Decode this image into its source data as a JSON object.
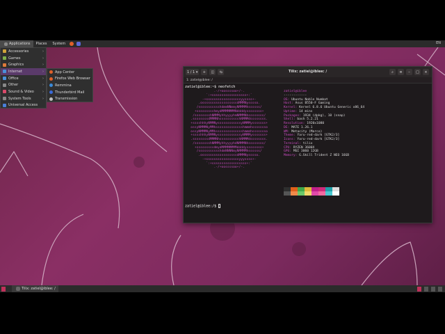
{
  "topbar": {
    "menus": [
      "Applications",
      "Places",
      "System"
    ],
    "tray": "EN"
  },
  "apps_menu": {
    "items": [
      {
        "label": "Accessories",
        "color": "#d0a33a"
      },
      {
        "label": "Games",
        "color": "#7fb04a"
      },
      {
        "label": "Graphics",
        "color": "#e07a3a"
      },
      {
        "label": "Internet",
        "color": "#4a90d9"
      },
      {
        "label": "Office",
        "color": "#4a90d9"
      },
      {
        "label": "Other",
        "color": "#888888"
      },
      {
        "label": "Sound & Video",
        "color": "#d94a6a"
      },
      {
        "label": "System Tools",
        "color": "#888888"
      },
      {
        "label": "Universal Access",
        "color": "#4a7fd9"
      }
    ],
    "submenu": [
      {
        "label": "App Center",
        "color": "#e0602a"
      },
      {
        "label": "Firefox Web Browser",
        "color": "#e0602a"
      },
      {
        "label": "Remmina",
        "color": "#3a8ad9"
      },
      {
        "label": "Thunderbird Mail",
        "color": "#3a6ad9"
      },
      {
        "label": "Transmission",
        "color": "#c0c0c0"
      }
    ]
  },
  "terminal": {
    "title": "Tilix: zatiel@iblee: /",
    "tab_counter": "1 / 1",
    "tab_label": "1: zatiel@iblee: /",
    "prompt_line": "zatiel@iblee:~$ neofetch",
    "prompt_final": "zatiel@iblee:/$ ",
    "ascii_art": "               .-/+oossssoo+/-.\n           `:+ssssssssssssssssss+:`\n         -+ssssssssssssssssssyyssss+-\n       .ossssssssssssssssssdMMMNysssso.\n      /ssssssssssshdmmNNmmyNMMMMhssssss/\n     +ssssssssshmydMMMMMMMNddddyssssssss+\n    /sssssssshNMMMyhhyyyyhmNMMMNhssssssss/\n   .ssssssssdMMMNhsssssssssshNMMMdssssssss.\n   +sssshhhyNMMNyssssssssssssyNMMMysssssss+\n   ossyNMMMNyMMhsssssssssssssshmmmhssssssso\n   ossyNMMMNyMMhsssssssssssssshmmmhssssssso\n   +sssshhhyNMMNyssssssssssssyNMMMysssssss+\n   .ssssssssdMMMNhsssssssssshNMMMdssssssss.\n    /sssssssshNMMMyhhyyyyhdNMMMNhssssssss/\n     +sssssssssdmydMMMMMMMMddddyssssssss+\n      /ssssssssssshdmNNNNmyNMMMMhssssss/\n       .ossssssssssssssssssdMMMNysssso.\n         -+sssssssssssssssssyyyssss+-\n           `:+ssssssssssssssssss+:`\n               .-/+oossssoo+/-.",
    "info": {
      "user_host": "zatiel@iblee",
      "separator": "------------",
      "rows": [
        {
          "key": "OS",
          "value": "Ubuntu Noble Numbat"
        },
        {
          "key": "Host",
          "value": "Asus B550-F Gaming"
        },
        {
          "key": "Kernel",
          "value": "Kernel 6.8.6 Ubuntu Generic x86_64"
        },
        {
          "key": "Uptime",
          "value": "14 mins"
        },
        {
          "key": "Packages",
          "value": "1934 (dpkg), 10 (snap)"
        },
        {
          "key": "Shell",
          "value": "bash 5.2.21"
        },
        {
          "key": "Resolution",
          "value": "1920x1080"
        },
        {
          "key": "DE",
          "value": "MATE 1.26.1"
        },
        {
          "key": "WM",
          "value": "Metacity (Marco)"
        },
        {
          "key": "Theme",
          "value": "Yaru-red-dark [GTK2/3]"
        },
        {
          "key": "Icons",
          "value": "Yaru-red-dark [GTK2/3]"
        },
        {
          "key": "Terminal",
          "value": "tilix"
        },
        {
          "key": "CPU",
          "value": "RYZEN 3600X"
        },
        {
          "key": "GPU",
          "value": "MSI 3060 12GB"
        },
        {
          "key": "Memory",
          "value": "G.Skill Trident Z NEO 16GB"
        }
      ]
    },
    "palette": [
      "#2e2e2e",
      "#e0601a",
      "#3fa84a",
      "#e0b83a",
      "#c0208a",
      "#d02a7a",
      "#1fa0a8",
      "#dddddd",
      "#555555",
      "#f08a4a",
      "#6ac86a",
      "#f0d86a",
      "#e04aa8",
      "#f06aa0",
      "#4ac8d0",
      "#ffffff"
    ]
  },
  "taskbar": {
    "task_label": "Tilix: zatiel@iblee: /"
  },
  "colors": {
    "accent": "#c94bc0",
    "wallpaper": "#7c2a5e"
  }
}
